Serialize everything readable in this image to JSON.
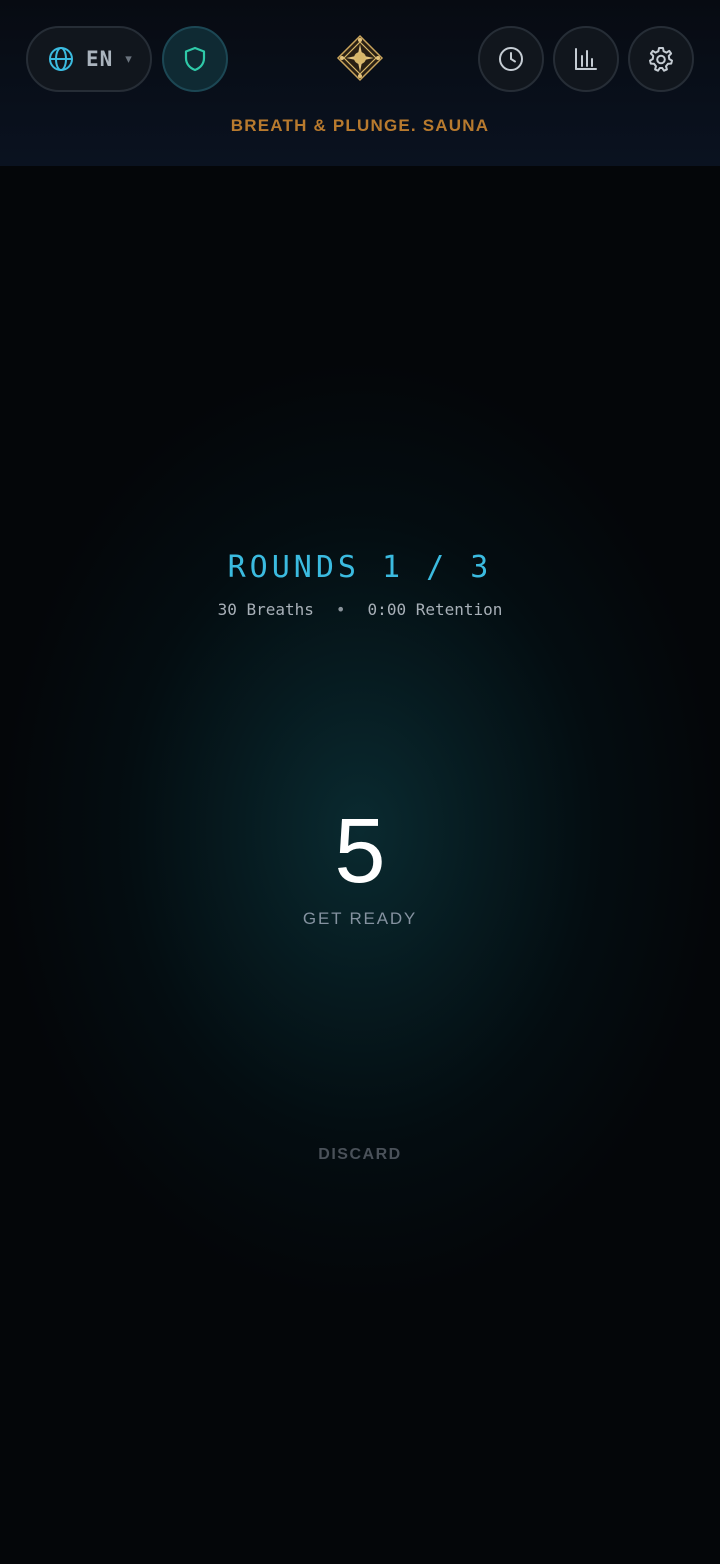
{
  "header": {
    "language": {
      "code": "EN",
      "caret": "▾",
      "icon": "globe-icon"
    },
    "privacy": {
      "icon": "shield-icon",
      "color": "#2fc9a8"
    },
    "logo": {
      "icon": "ornate-diamond-logo",
      "color": "#c9a45c"
    },
    "title": "BREATH & PLUNGE. SAUNA",
    "title_color": "#b87a2e",
    "actions": [
      {
        "name": "history",
        "icon": "clock-icon"
      },
      {
        "name": "stats",
        "icon": "bar-chart-icon"
      },
      {
        "name": "settings",
        "icon": "gear-icon"
      }
    ]
  },
  "session": {
    "rounds_label": "ROUNDS 1 / 3",
    "breaths": "30 Breaths",
    "separator": "•",
    "retention": "0:00 Retention",
    "countdown": "5",
    "status": "GET READY",
    "discard_label": "DISCARD",
    "accent": "#3bbbe0"
  }
}
